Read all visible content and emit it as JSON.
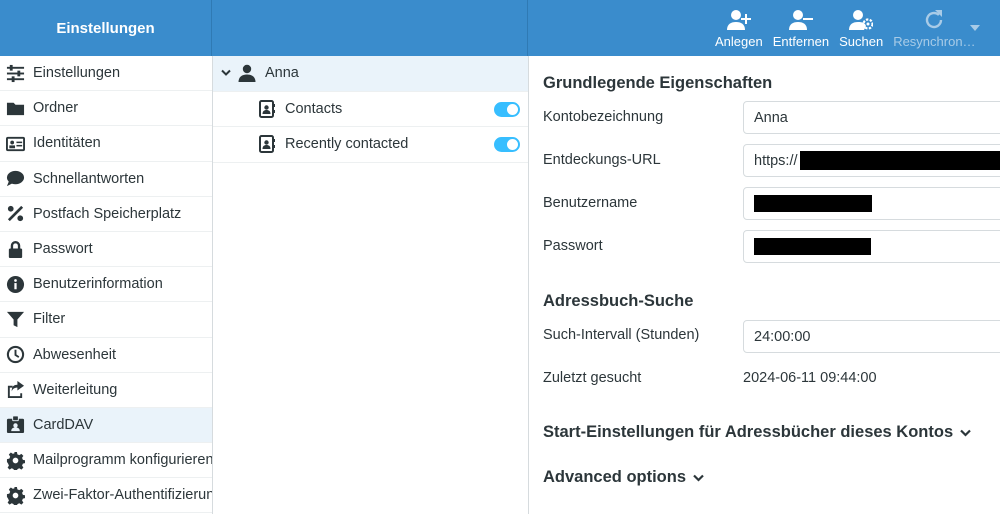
{
  "header": {
    "title": "Einstellungen",
    "toolbar": [
      {
        "label": "Anlegen",
        "icon": "add-user-icon",
        "enabled": true
      },
      {
        "label": "Entfernen",
        "icon": "remove-user-icon",
        "enabled": true
      },
      {
        "label": "Suchen",
        "icon": "search-users-icon",
        "enabled": true
      },
      {
        "label": "Resynchron…",
        "icon": "resync-icon",
        "enabled": false
      }
    ]
  },
  "sidebar": {
    "items": [
      {
        "label": "Einstellungen",
        "icon": "sliders-icon"
      },
      {
        "label": "Ordner",
        "icon": "folder-icon"
      },
      {
        "label": "Identitäten",
        "icon": "id-card-icon"
      },
      {
        "label": "Schnellantworten",
        "icon": "comment-icon"
      },
      {
        "label": "Postfach Speicherplatz",
        "icon": "percent-icon"
      },
      {
        "label": "Passwort",
        "icon": "lock-icon"
      },
      {
        "label": "Benutzerinformation",
        "icon": "info-icon"
      },
      {
        "label": "Filter",
        "icon": "filter-icon"
      },
      {
        "label": "Abwesenheit",
        "icon": "clock-icon"
      },
      {
        "label": "Weiterleitung",
        "icon": "share-icon"
      },
      {
        "label": "CardDAV",
        "icon": "badge-icon",
        "active": true
      },
      {
        "label": "Mailprogramm konfigurieren",
        "icon": "gear-icon"
      },
      {
        "label": "Zwei-Faktor-Authentifizierung",
        "icon": "gear-icon"
      }
    ]
  },
  "accounts": {
    "account_name": "Anna",
    "addressbooks": [
      {
        "label": "Contacts",
        "enabled": true
      },
      {
        "label": "Recently contacted",
        "enabled": true
      }
    ]
  },
  "details": {
    "basic_title": "Grundlegende Eigenschaften",
    "fields": {
      "account_label": "Kontobezeichnung",
      "account_value": "Anna",
      "url_label": "Entdeckungs-URL",
      "url_value": "https://",
      "username_label": "Benutzername",
      "password_label": "Passwort"
    },
    "search_title": "Adressbuch-Suche",
    "interval_label": "Such-Intervall (Stunden)",
    "interval_value": "24:00:00",
    "last_search_label": "Zuletzt gesucht",
    "last_search_value": "2024-06-11 09:44:00",
    "startup_title": "Start-Einstellungen für Adressbücher dieses Kontos",
    "advanced_title": "Advanced options"
  },
  "colors": {
    "header_bg": "#3a8ccc",
    "active_bg": "#eaf3fa",
    "toggle_on": "#37beff"
  }
}
